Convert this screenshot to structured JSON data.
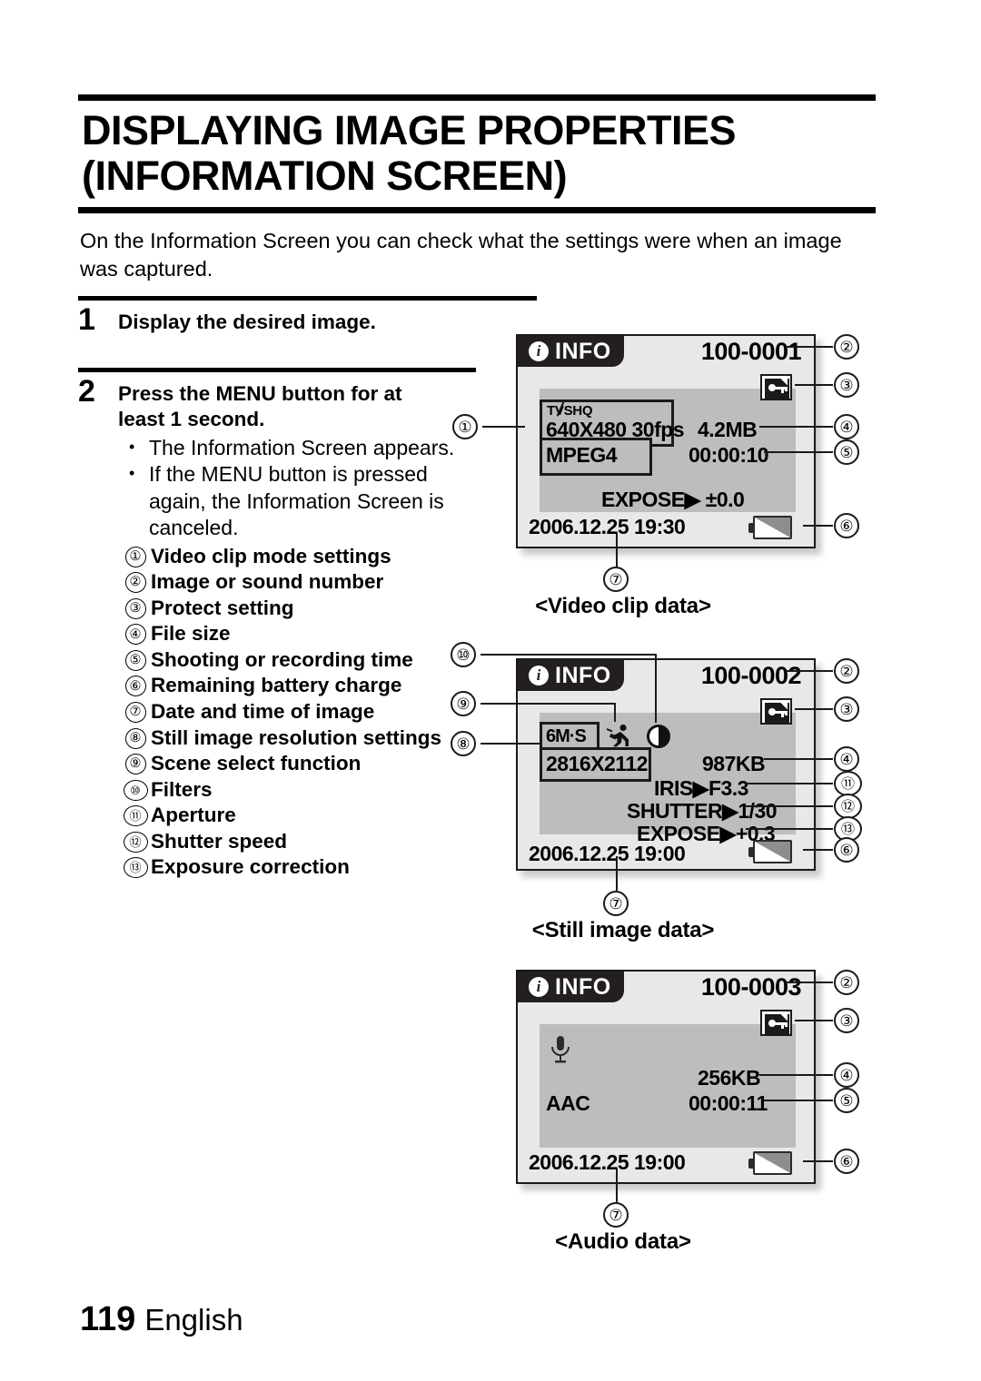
{
  "document": {
    "title": "DISPLAYING IMAGE PROPERTIES (INFORMATION SCREEN)",
    "intro": "On the Information Screen you can check what the settings were when an image was captured.",
    "page_number": "119",
    "language": "English"
  },
  "steps": [
    {
      "num": "1",
      "text": "Display the desired image."
    },
    {
      "num": "2",
      "text": "Press the MENU button for at least 1 second."
    }
  ],
  "bullets": [
    "The Information Screen appears.",
    "If the MENU button is pressed again, the Information Screen is canceled."
  ],
  "legend": [
    {
      "num": "①",
      "label": "Video clip mode settings"
    },
    {
      "num": "②",
      "label": "Image or sound number"
    },
    {
      "num": "③",
      "label": "Protect setting"
    },
    {
      "num": "④",
      "label": "File size"
    },
    {
      "num": "⑤",
      "label": "Shooting or recording time"
    },
    {
      "num": "⑥",
      "label": "Remaining battery charge"
    },
    {
      "num": "⑦",
      "label": "Date and time of image"
    },
    {
      "num": "⑧",
      "label": "Still image resolution settings"
    },
    {
      "num": "⑨",
      "label": "Scene select function"
    },
    {
      "num": "⑩",
      "label": "Filters"
    },
    {
      "num": "⑪",
      "label": "Aperture"
    },
    {
      "num": "⑫",
      "label": "Shutter speed"
    },
    {
      "num": "⑬",
      "label": "Exposure correction"
    }
  ],
  "figures": {
    "video": {
      "caption": "<Video clip data>",
      "info_label": "INFO",
      "file_number": "100-0001",
      "quality_tag": "SHQ",
      "quality_prefix": "T",
      "quality_v": "V",
      "resolution": "640X480 30fps",
      "codec": "MPEG4",
      "file_size": "4.2MB",
      "duration": "00:00:10",
      "expose_label": "EXPOSE",
      "expose_value": "±0.0",
      "datetime": "2006.12.25 19:30",
      "callouts": {
        "c1": "①",
        "c2": "②",
        "c3": "③",
        "c4": "④",
        "c5": "⑤",
        "c6": "⑥",
        "c7": "⑦"
      }
    },
    "still": {
      "caption": "<Still image data>",
      "info_label": "INFO",
      "file_number": "100-0002",
      "size_tag": "6M·S",
      "resolution": "2816X2112",
      "file_size": "987KB",
      "iris_label": "IRIS",
      "iris_value": "F3.3",
      "shutter_label": "SHUTTER",
      "shutter_value": "1/30",
      "expose_label": "EXPOSE",
      "expose_value": "+0.3",
      "datetime": "2006.12.25 19:00",
      "callouts": {
        "c2": "②",
        "c3": "③",
        "c4": "④",
        "c6": "⑥",
        "c7": "⑦",
        "c8": "⑧",
        "c9": "⑨",
        "c10": "⑩",
        "c11": "⑪",
        "c12": "⑫",
        "c13": "⑬"
      }
    },
    "audio": {
      "caption": "<Audio data>",
      "info_label": "INFO",
      "file_number": "100-0003",
      "codec": "AAC",
      "file_size": "256KB",
      "duration": "00:00:11",
      "datetime": "2006.12.25 19:00",
      "callouts": {
        "c2": "②",
        "c3": "③",
        "c4": "④",
        "c5": "⑤",
        "c6": "⑥",
        "c7": "⑦"
      }
    }
  },
  "colors": {
    "lcd_outer": "#e8e8e8",
    "lcd_inner": "#bdbdbd",
    "info_bar": "#231f20",
    "ink": "#000000"
  }
}
